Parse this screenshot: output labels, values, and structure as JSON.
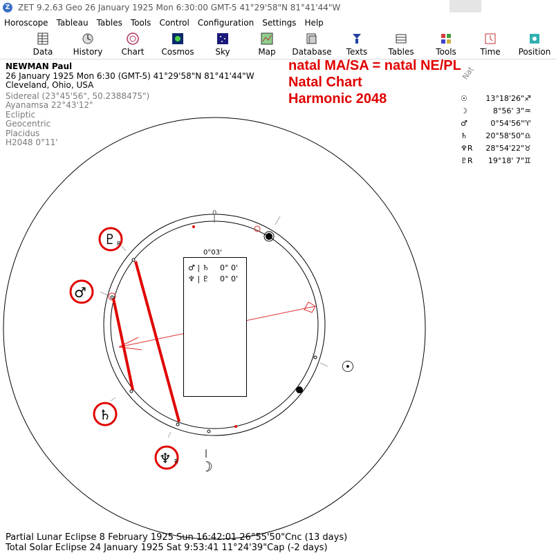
{
  "window": {
    "title": "ZET 9.2.63 Geo   26 January 1925   Mon    6:30:00 GMT-5 41°29'58\"N  81°41'44\"W"
  },
  "menu": [
    "Horoscope",
    "Tableau",
    "Tables",
    "Tools",
    "Control",
    "Configuration",
    "Settings",
    "Help"
  ],
  "toolbar": [
    {
      "label": "Data",
      "icon": "data-grid-icon"
    },
    {
      "label": "History",
      "icon": "history-icon"
    },
    {
      "label": "Chart",
      "icon": "chart-wheel-icon"
    },
    {
      "label": "Cosmos",
      "icon": "cosmos-icon"
    },
    {
      "label": "Sky",
      "icon": "sky-icon"
    },
    {
      "label": "Map",
      "icon": "map-icon"
    },
    {
      "label": "Database",
      "icon": "database-icon"
    },
    {
      "label": "Texts",
      "icon": "texts-icon"
    },
    {
      "label": "Tables",
      "icon": "tables-icon"
    },
    {
      "label": "Tools",
      "icon": "tools-icon"
    },
    {
      "label": "Time",
      "icon": "time-icon"
    },
    {
      "label": "Position",
      "icon": "position-icon"
    }
  ],
  "chart_info": {
    "name": "NEWMAN Paul",
    "date_line": "26 January 1925  Mon    6:30 (GMT-5) 41°29'58\"N  81°41'44\"W",
    "place": "Cleveland, Ohio, USA",
    "settings": [
      "Sidereal (23°45'56\", 50.2388475\")",
      "Ayanamsa 22°43'12\"",
      "Ecliptic",
      "Geocentric",
      "Placidus",
      "H2048   0°11'"
    ]
  },
  "annotation": {
    "line1": "natal MA/SA = natal NE/PL",
    "line2": "Natal Chart",
    "line3": "Harmonic 2048"
  },
  "planet_table": {
    "header": "Nat",
    "rows": [
      {
        "symbol": "☉",
        "value": "13°18'26\"",
        "sign": "♐"
      },
      {
        "symbol": "☽",
        "value": "8°56' 3\"",
        "sign": "♒"
      },
      {
        "symbol": "♂",
        "value": "0°54'56\"",
        "sign": "♈"
      },
      {
        "symbol": "♄",
        "value": "20°58'50\"",
        "sign": "♎"
      },
      {
        "symbol": "♆R",
        "value": "28°54'22\"",
        "sign": "♉"
      },
      {
        "symbol": "♇R",
        "value": "19°18' 7\"",
        "sign": "♊"
      }
    ]
  },
  "midpoint_box": {
    "orb": "0°03'",
    "rows": [
      {
        "pair": "♂ | ♄",
        "value": "0° 0'"
      },
      {
        "pair": "♆ | ♇",
        "value": "0° 0'"
      }
    ]
  },
  "wheel": {
    "top_label": "0",
    "planets": [
      {
        "glyph": "♇",
        "suffix": "R",
        "circled": true
      },
      {
        "glyph": "♂",
        "suffix": "",
        "circled": true
      },
      {
        "glyph": "♄",
        "suffix": "",
        "circled": true
      },
      {
        "glyph": "♆",
        "suffix": "R",
        "circled": true
      },
      {
        "glyph": "☽",
        "suffix": "",
        "circled": false
      },
      {
        "glyph": "☉",
        "suffix": "",
        "circled": false
      }
    ]
  },
  "footer": {
    "line1": "Partial Lunar Eclipse 8 February 1925 Sun 16:42:01 26°55'50\"Cnc (13 days)",
    "line2": "Total Solar Eclipse 24 January 1925 Sat  9:53:41 11°24'39\"Cap (-2 days)"
  },
  "colors": {
    "highlight_red": "#e00000",
    "midpoint_red": "#e03030"
  }
}
